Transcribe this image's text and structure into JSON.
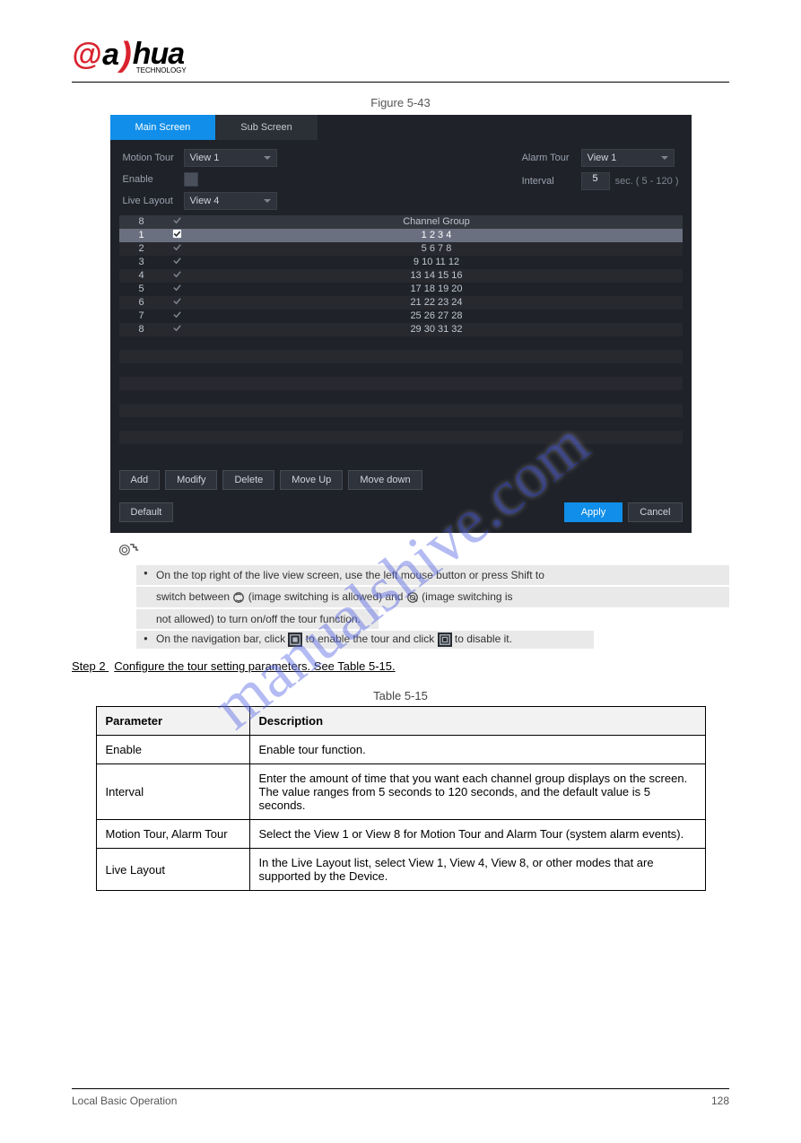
{
  "watermark": "manualshive.com",
  "logo": {
    "a1": "a",
    "paren": ")",
    "rest": "hua",
    "sub": "TECHNOLOGY"
  },
  "figure_title": "Figure 5-43",
  "screenshot": {
    "tabs": {
      "main": "Main Screen",
      "sub": "Sub Screen"
    },
    "left": {
      "motion_tour_label": "Motion Tour",
      "motion_tour_value": "View 1",
      "enable_label": "Enable",
      "live_layout_label": "Live Layout",
      "live_layout_value": "View 4"
    },
    "right": {
      "alarm_tour_label": "Alarm Tour",
      "alarm_tour_value": "View 1",
      "interval_label": "Interval",
      "interval_value": "5",
      "interval_hint": "sec.  ( 5 - 120 )"
    },
    "table": {
      "hdr_num": "8",
      "hdr_group": "Channel Group",
      "rows": [
        {
          "n": "1",
          "group": "1  2  3  4",
          "selected": true
        },
        {
          "n": "2",
          "group": "5  6  7  8"
        },
        {
          "n": "3",
          "group": "9 10 11 12"
        },
        {
          "n": "4",
          "group": "13 14 15 16"
        },
        {
          "n": "5",
          "group": "17 18 19 20"
        },
        {
          "n": "6",
          "group": "21 22 23 24"
        },
        {
          "n": "7",
          "group": "25 26 27 28"
        },
        {
          "n": "8",
          "group": "29 30 31 32"
        }
      ]
    },
    "buttons": {
      "add": "Add",
      "modify": "Modify",
      "delete": "Delete",
      "moveup": "Move Up",
      "movedown": "Move down"
    },
    "footer": {
      "default": "Default",
      "apply": "Apply",
      "cancel": "Cancel"
    }
  },
  "notes": {
    "n1": "On the top right of the live view screen, use the left mouse button or press Shift to",
    "n1b_pre": "switch between ",
    "n1b_mid": " (image switching is allowed) and ",
    "n1b_post": " (image switching is",
    "n1c": "not allowed) to turn on/off the tour function.",
    "n2_pre": "On the navigation bar, click ",
    "n2_mid": " to enable the tour and click ",
    "n2_post": " to disable it."
  },
  "step_label": "Step 2",
  "step_text": "Configure the tour setting parameters. See Table 5-15.",
  "table_caption": "Table 5-15",
  "param_table": {
    "hdr_p": "Parameter",
    "hdr_d": "Description",
    "rows": [
      {
        "p": "Enable",
        "d": "Enable tour function."
      },
      {
        "p": "Interval",
        "d": "Enter the amount of time that you want each channel group displays on the screen. The value ranges from 5 seconds to 120 seconds, and the default value is 5 seconds."
      },
      {
        "p": "Motion Tour, Alarm Tour",
        "d": "Select the View 1 or View 8 for Motion Tour and Alarm Tour (system alarm events)."
      },
      {
        "p": "Live Layout",
        "d": "In the Live Layout list, select View 1, View 4, View 8, or other modes that are supported by the Device."
      }
    ]
  },
  "page_footer": {
    "left": "Local Basic Operation",
    "right": "128"
  }
}
